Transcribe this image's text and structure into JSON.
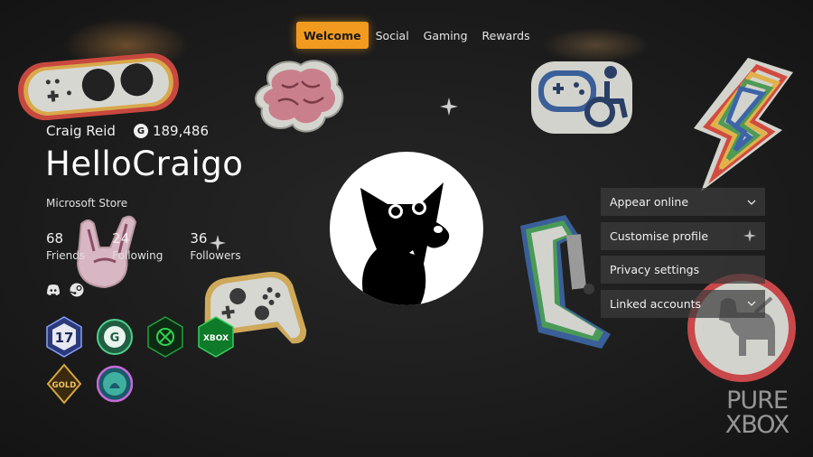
{
  "nav": {
    "tabs": [
      {
        "label": "Welcome",
        "active": true
      },
      {
        "label": "Social",
        "active": false
      },
      {
        "label": "Gaming",
        "active": false
      },
      {
        "label": "Rewards",
        "active": false
      }
    ]
  },
  "profile": {
    "real_name": "Craig Reid",
    "gamerscore_icon": "G",
    "gamerscore": "189,486",
    "gamertag": "HelloCraigo",
    "subtitle": "Microsoft Store",
    "stats": [
      {
        "value": "68",
        "label": "Friends"
      },
      {
        "value": "24",
        "label": "Following"
      },
      {
        "value": "36",
        "label": "Followers"
      }
    ],
    "linked_icons": [
      "discord-icon",
      "steam-icon"
    ],
    "badges": [
      "badge-17-years",
      "badge-gamerscore",
      "badge-xbox-logo",
      "badge-xbox-ambassador",
      "badge-gold",
      "badge-weekly-set"
    ],
    "badge_texts": {
      "years": "17",
      "gs": "G",
      "ambassador": "XBOX",
      "gold": "GOLD"
    }
  },
  "menu": {
    "items": [
      {
        "label": "Appear online",
        "icon": "chevron-down-icon"
      },
      {
        "label": "Customise profile",
        "icon": "sparkle-icon"
      },
      {
        "label": "Privacy settings",
        "icon": ""
      },
      {
        "label": "Linked accounts",
        "icon": "chevron-down-icon"
      }
    ]
  },
  "watermark": {
    "line1": "PURE",
    "line2": "XBOX"
  },
  "colors": {
    "accent": "#f29a1f",
    "menu_bg": "#3c3c3c",
    "background": "#1c1c1c"
  }
}
